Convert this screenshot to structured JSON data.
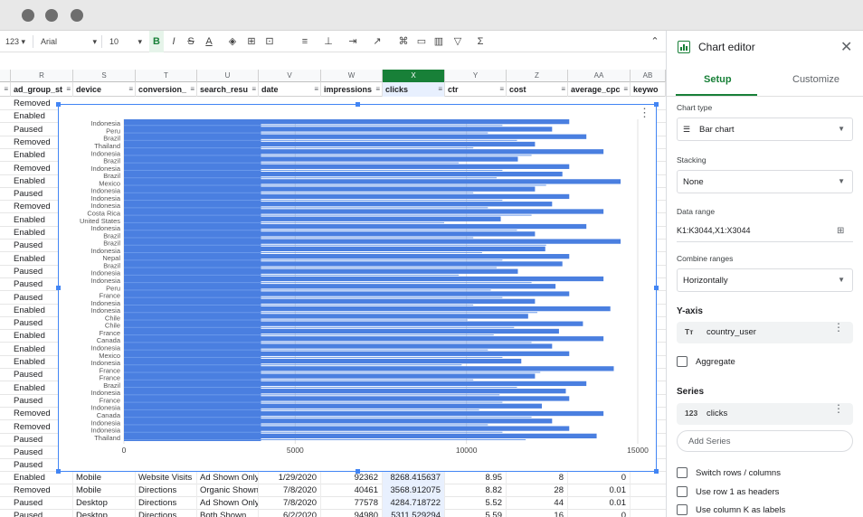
{
  "toolbar": {
    "format_label": "123",
    "font_name": "Arial",
    "font_size": "10"
  },
  "sheet": {
    "columns": [
      {
        "letter": "R",
        "header": "ad_group_st"
      },
      {
        "letter": "S",
        "header": "device"
      },
      {
        "letter": "T",
        "header": "conversion_"
      },
      {
        "letter": "U",
        "header": "search_resu"
      },
      {
        "letter": "V",
        "header": "date"
      },
      {
        "letter": "W",
        "header": "impressions"
      },
      {
        "letter": "X",
        "header": "clicks"
      },
      {
        "letter": "Y",
        "header": "ctr"
      },
      {
        "letter": "Z",
        "header": "cost"
      },
      {
        "letter": "AA",
        "header": "average_cpc"
      },
      {
        "letter": "AB",
        "header": "keywo"
      }
    ],
    "left_statuses": [
      "Removed",
      "Enabled",
      "Paused",
      "Removed",
      "Enabled",
      "Removed",
      "Enabled",
      "Paused",
      "Removed",
      "Enabled",
      "Enabled",
      "Paused",
      "Enabled",
      "Paused",
      "Paused",
      "Paused",
      "Enabled",
      "Paused",
      "Enabled",
      "Enabled",
      "Enabled",
      "Paused",
      "Enabled",
      "Paused",
      "Removed",
      "Removed",
      "Paused",
      "Paused",
      "Paused"
    ],
    "bottom_rows": [
      {
        "status": "Enabled",
        "device": "Mobile",
        "conversion": "Website Visits",
        "search": "Ad Shown Only",
        "date": "1/29/2020",
        "impressions": "92362",
        "clicks": "8268.415637",
        "ctr": "8.95",
        "cost": "8",
        "cpc": "0"
      },
      {
        "status": "Removed",
        "device": "Mobile",
        "conversion": "Directions",
        "search": "Organic Shown O",
        "date": "7/8/2020",
        "impressions": "40461",
        "clicks": "3568.912075",
        "ctr": "8.82",
        "cost": "28",
        "cpc": "0.01"
      },
      {
        "status": "Paused",
        "device": "Desktop",
        "conversion": "Directions",
        "search": "Ad Shown Only",
        "date": "7/8/2020",
        "impressions": "77578",
        "clicks": "4284.718722",
        "ctr": "5.52",
        "cost": "44",
        "cpc": "0.01"
      },
      {
        "status": "Paused",
        "device": "Desktop",
        "conversion": "Directions",
        "search": "Both Shown",
        "date": "6/2/2020",
        "impressions": "94980",
        "clicks": "5311.529294",
        "ctr": "5.59",
        "cost": "16",
        "cpc": "0"
      }
    ]
  },
  "chart_data": {
    "type": "bar",
    "orientation": "horizontal",
    "categories": [
      "Indonesia",
      "Peru",
      "Brazil",
      "Thailand",
      "Indonesia",
      "Brazil",
      "Indonesia",
      "Brazil",
      "Mexico",
      "Indonesia",
      "Indonesia",
      "Indonesia",
      "Costa Rica",
      "United States",
      "Indonesia",
      "Brazil",
      "Brazil",
      "Indonesia",
      "Nepal",
      "Brazil",
      "Indonesia",
      "Indonesia",
      "Peru",
      "France",
      "Indonesia",
      "Indonesia",
      "Chile",
      "Chile",
      "France",
      "Canada",
      "Indonesia",
      "Mexico",
      "Indonesia",
      "France",
      "France",
      "Brazil",
      "Indonesia",
      "France",
      "Indonesia",
      "Canada",
      "Indonesia",
      "Indonesia",
      "Thailand"
    ],
    "x_ticks": [
      "0",
      "5000",
      "10000",
      "15000"
    ],
    "xlim": [
      0,
      15000
    ],
    "series": [
      {
        "values": [
          13000,
          12500,
          13500,
          12000,
          14000,
          11500,
          13000,
          12800,
          14500,
          12000,
          13000,
          12500,
          14000,
          11000,
          13500,
          12000,
          14500,
          12300,
          13000,
          12800,
          11500,
          14000,
          12600,
          13000,
          12000,
          14200,
          11800,
          13400,
          12700,
          14000,
          12500,
          13000,
          11600,
          14300,
          12000,
          13500,
          12900,
          13000,
          12200,
          14000,
          12500,
          13000,
          13800
        ]
      }
    ],
    "color": "#4a7fe0",
    "grid": true,
    "legend": "none"
  },
  "editor": {
    "title": "Chart editor",
    "tabs": [
      "Setup",
      "Customize"
    ],
    "chart_type_label": "Chart type",
    "chart_type_value": "Bar chart",
    "stacking_label": "Stacking",
    "stacking_value": "None",
    "data_range_label": "Data range",
    "data_range_value": "K1:K3044,X1:X3044",
    "combine_label": "Combine ranges",
    "combine_value": "Horizontally",
    "yaxis_label": "Y-axis",
    "yaxis_value": "country_user",
    "yaxis_icon": "Tт",
    "aggregate_label": "Aggregate",
    "series_label": "Series",
    "series_value": "clicks",
    "series_icon": "123",
    "add_series_label": "Add Series",
    "switch_label": "Switch rows / columns",
    "row1_label": "Use row 1 as headers",
    "colk_label": "Use column K as labels"
  }
}
